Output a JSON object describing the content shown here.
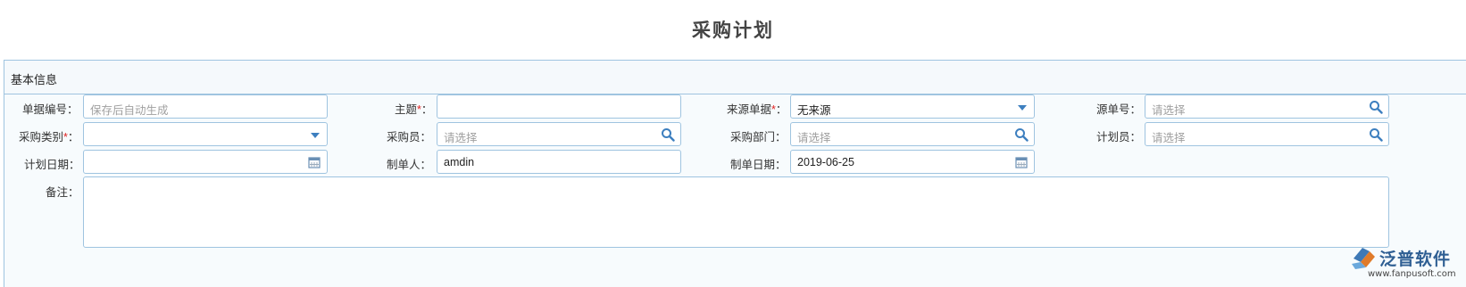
{
  "page": {
    "title": "采购计划"
  },
  "section": {
    "title": "基本信息"
  },
  "fields": {
    "bill_no": {
      "label": "单据编号：",
      "placeholder": "保存后自动生成"
    },
    "subject": {
      "label": "主题",
      "value": ""
    },
    "source_bill": {
      "label": "来源单据",
      "value": "无来源"
    },
    "source_no": {
      "label": "源单号：",
      "placeholder": "请选择"
    },
    "purchase_type": {
      "label": "采购类别",
      "value": ""
    },
    "buyer": {
      "label": "采购员：",
      "placeholder": "请选择"
    },
    "purchase_dept": {
      "label": "采购部门：",
      "placeholder": "请选择"
    },
    "planner": {
      "label": "计划员：",
      "placeholder": "请选择"
    },
    "plan_date": {
      "label": "计划日期：",
      "value": ""
    },
    "creator": {
      "label": "制单人：",
      "value": "amdin"
    },
    "create_date": {
      "label": "制单日期：",
      "value": "2019-06-25"
    },
    "remark": {
      "label": "备注：",
      "value": ""
    }
  },
  "required_mark": "*",
  "colon": "：",
  "watermark": {
    "name": "泛普软件",
    "url": "www.fanpusoft.com"
  },
  "colors": {
    "border": "#9fc4e0",
    "icon": "#3d7fbf",
    "required": "#e02020",
    "panel_bg": "#f7fbfd"
  }
}
